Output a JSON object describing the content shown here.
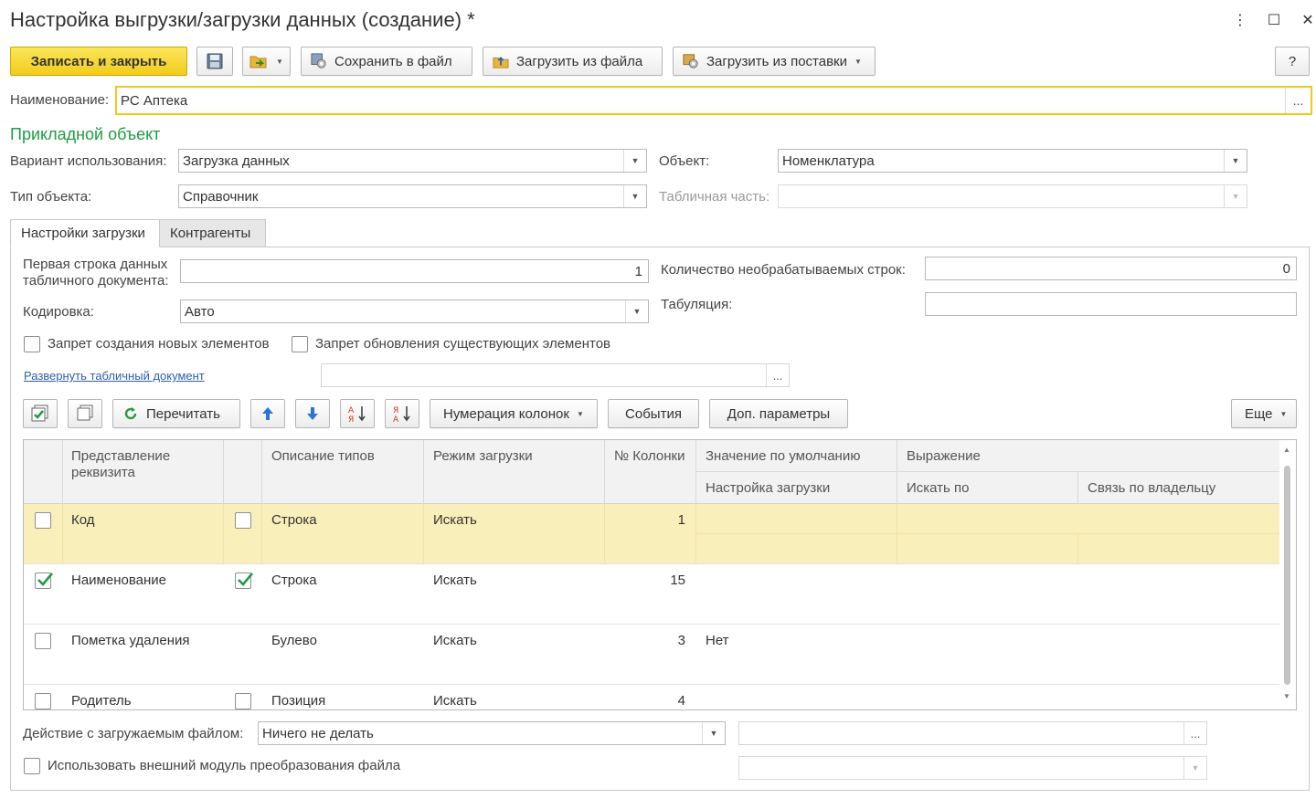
{
  "window": {
    "title": "Настройка выгрузки/загрузки данных (создание) *",
    "controls": {
      "more": "⋮",
      "maximize": "☐",
      "close": "✕"
    }
  },
  "toolbar": {
    "save_close": "Записать и закрыть",
    "save_file": "Сохранить в файл",
    "load_file": "Загрузить из файла",
    "load_supply": "Загрузить из поставки",
    "help": "?"
  },
  "name": {
    "label": "Наименование:",
    "value": "РС Аптека",
    "choose": "..."
  },
  "section_title": "Прикладной объект",
  "usage": {
    "label": "Вариант использования:",
    "value": "Загрузка данных"
  },
  "object": {
    "label": "Объект:",
    "value": "Номенклатура"
  },
  "object_type": {
    "label": "Тип объекта:",
    "value": "Справочник"
  },
  "tabular_part": {
    "label": "Табличная часть:",
    "value": ""
  },
  "tabs": [
    {
      "label": "Настройки загрузки"
    },
    {
      "label": "Контрагенты"
    }
  ],
  "settings": {
    "first_row_label": "Первая строка данных табличного документа:",
    "first_row_line1": "Первая строка данных",
    "first_row_line2": "табличного документа:",
    "first_row_value": "1",
    "skip_rows_label": "Количество необрабатываемых строк:",
    "skip_rows_value": "0",
    "encoding_label": "Кодировка:",
    "encoding_value": "Авто",
    "tab_label": "Табуляция:",
    "tab_value": "",
    "deny_create": "Запрет создания новых элементов",
    "deny_update": "Запрет обновления существующих элементов",
    "expand_link": "Развернуть табличный документ",
    "expand_choose": "..."
  },
  "grid_toolbar": {
    "reread": "Перечитать",
    "numbering": "Нумерация колонок",
    "events": "События",
    "extra": "Доп. параметры",
    "more": "Еще"
  },
  "grid": {
    "headers": {
      "attr": "Представление реквизита",
      "attr_line1": "Представление",
      "attr_line2": "реквизита",
      "types": "Описание типов",
      "mode": "Режим загрузки",
      "col": "№ Колонки",
      "default": "Значение по умолчанию",
      "expr": "Выражение",
      "load_setting": "Настройка загрузки",
      "search_by": "Искать по",
      "owner_link": "Связь по владельцу"
    },
    "rows": [
      {
        "use": false,
        "attr": "Код",
        "type_check": false,
        "types": "Строка",
        "mode": "Искать",
        "col": "1",
        "default": ""
      },
      {
        "use": true,
        "attr": "Наименование",
        "type_check": true,
        "types": "Строка",
        "mode": "Искать",
        "col": "15",
        "default": ""
      },
      {
        "use": false,
        "attr": "Пометка удаления",
        "type_check": null,
        "types": "Булево",
        "mode": "Искать",
        "col": "3",
        "default": "Нет"
      },
      {
        "use": false,
        "attr": "Родитель",
        "type_check": false,
        "types": "Позиция",
        "mode": "Искать",
        "col": "4",
        "default": ""
      }
    ]
  },
  "footer": {
    "action_label": "Действие с загружаемым файлом:",
    "action_value": "Ничего не делать",
    "path_value": "",
    "path_choose": "...",
    "external_module": "Использовать внешний модуль преобразования файла",
    "module_value": ""
  },
  "colors": {
    "accent": "#f2cc1b",
    "section_green": "#1e9c43",
    "selected_row": "#f9efba",
    "link": "#2f5fae"
  }
}
